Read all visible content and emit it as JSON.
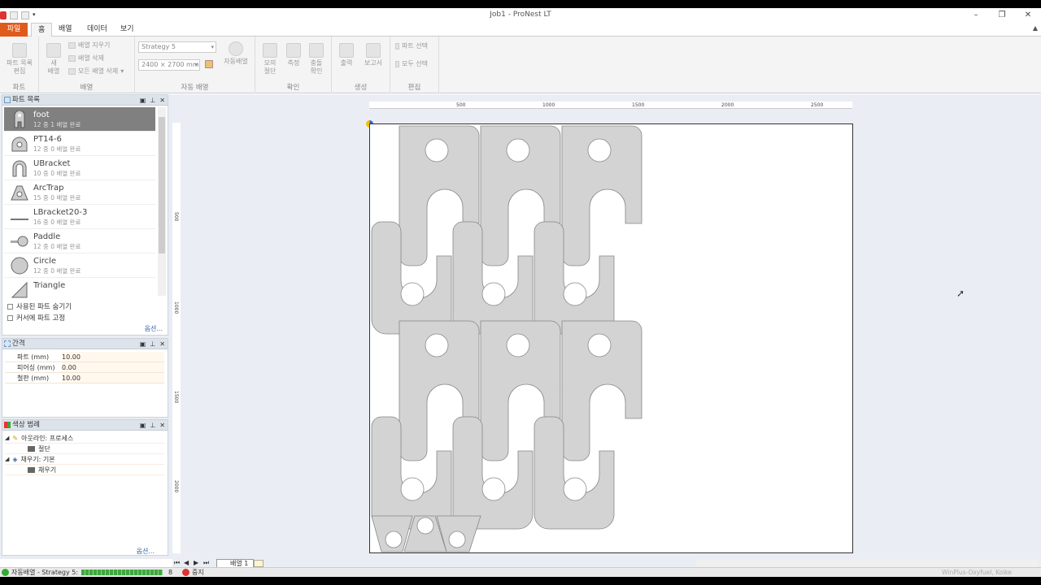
{
  "window": {
    "title": "Job1 - ProNest LT"
  },
  "tabs": [
    {
      "label": "파일"
    },
    {
      "label": "홈"
    },
    {
      "label": "배열"
    },
    {
      "label": "데이터"
    },
    {
      "label": "보기"
    }
  ],
  "ribbon": {
    "groups": {
      "part": "파트",
      "nest": "배열",
      "auto": "자동 배열",
      "confirm": "확인",
      "produce": "생성",
      "edit": "편집"
    },
    "part_list_edit": "파트 목록\n편집",
    "new_nest": "새\n배열",
    "clear_nest": "배열 지우기",
    "delete_nest": "배열 삭제",
    "delete_all": "모든 배열 삭제",
    "strategy": "Strategy 5",
    "sheet_size": "2400 × 2700 mm",
    "auto_nest": "자동배열",
    "common_cut": "모의\n절단",
    "measure": "측정",
    "collision": "충돌\n확인",
    "output": "출력",
    "report": "보고서",
    "select_part": "파트 선택",
    "select_all": "모두 선택"
  },
  "parts_panel": {
    "title": "파트 목록",
    "items": [
      {
        "name": "foot",
        "status": "12 중 1 배열 완료",
        "icon": "foot-icon"
      },
      {
        "name": "PT14-6",
        "status": "12 중 0 배열 완료",
        "icon": "pt14-icon"
      },
      {
        "name": "UBracket",
        "status": "10 중 0 배열 완료",
        "icon": "ubracket-icon"
      },
      {
        "name": "ArcTrap",
        "status": "15 중 0 배열 완료",
        "icon": "arctrap-icon"
      },
      {
        "name": "LBracket20-3",
        "status": "16 중 0 배열 완료",
        "icon": "lbracket-icon"
      },
      {
        "name": "Paddle",
        "status": "12 중 0 배열 완료",
        "icon": "paddle-icon"
      },
      {
        "name": "Circle",
        "status": "12 중 0 배열 완료",
        "icon": "circle-icon"
      },
      {
        "name": "Triangle",
        "status": "",
        "icon": "triangle-icon"
      }
    ],
    "hide_used": "사용된 파트 숨기기",
    "pin_cursor": "커서에 파트 고정",
    "options": "옵션..."
  },
  "spacing_panel": {
    "title": "간격",
    "rows": [
      {
        "label": "파트 (mm)",
        "value": "10.00"
      },
      {
        "label": "피어싱 (mm)",
        "value": "0.00"
      },
      {
        "label": "철판 (mm)",
        "value": "10.00"
      }
    ]
  },
  "legend_panel": {
    "title": "색상 범례",
    "nodes": [
      {
        "label": "아웃라인: 프로세스",
        "child": "절단"
      },
      {
        "label": "채우기: 기본",
        "child": "채우기"
      }
    ],
    "options": "옵션..."
  },
  "ruler": {
    "h": [
      "500",
      "1000",
      "1500",
      "2000",
      "2500"
    ],
    "v": [
      "500",
      "1000",
      "1500",
      "2000"
    ]
  },
  "sheet_tab": "배열 1",
  "status": {
    "text": "자동배열 - Strategy 5:",
    "count": "8",
    "stop": "중지",
    "watermark": "WinPlus-Oxyfuel, Koike"
  },
  "colors": {
    "file_tab": "#e05a1c",
    "part_fill": "#d3d3d3",
    "part_stroke": "#888888",
    "progress": "#3fa83f"
  }
}
